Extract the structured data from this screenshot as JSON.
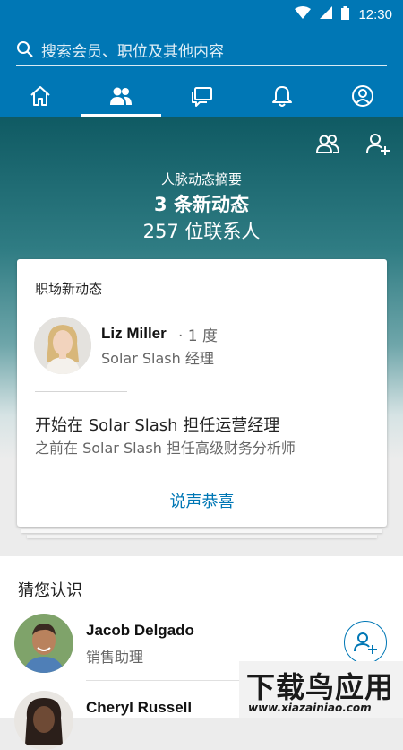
{
  "status_bar": {
    "time": "12:30"
  },
  "search": {
    "placeholder": "搜索会员、职位及其他内容"
  },
  "tabs": [
    {
      "icon": "home-icon"
    },
    {
      "icon": "network-icon",
      "active": true
    },
    {
      "icon": "messages-icon"
    },
    {
      "icon": "notifications-icon"
    },
    {
      "icon": "profile-icon"
    }
  ],
  "summary": {
    "label": "人脉动态摘要",
    "updates": "3 条新动态",
    "contacts": "257 位联系人"
  },
  "card": {
    "title": "职场新动态",
    "person": {
      "name": "Liz Miller",
      "degree": "· 1 度",
      "title": "Solar Slash 经理"
    },
    "update_main": "开始在 Solar Slash 担任运营经理",
    "update_sub": "之前在 Solar Slash 担任高级财务分析师",
    "action": "说声恭喜"
  },
  "pymk": {
    "title": "猜您认识",
    "people": [
      {
        "name": "Jacob Delgado",
        "title": "销售助理"
      },
      {
        "name": "Cheryl Russell",
        "title": ""
      }
    ]
  },
  "watermark": {
    "title": "下载鸟应用",
    "url": "www.xiazainiao.com"
  },
  "colors": {
    "brand": "#0077b5",
    "hero_top": "#0f5a63"
  }
}
